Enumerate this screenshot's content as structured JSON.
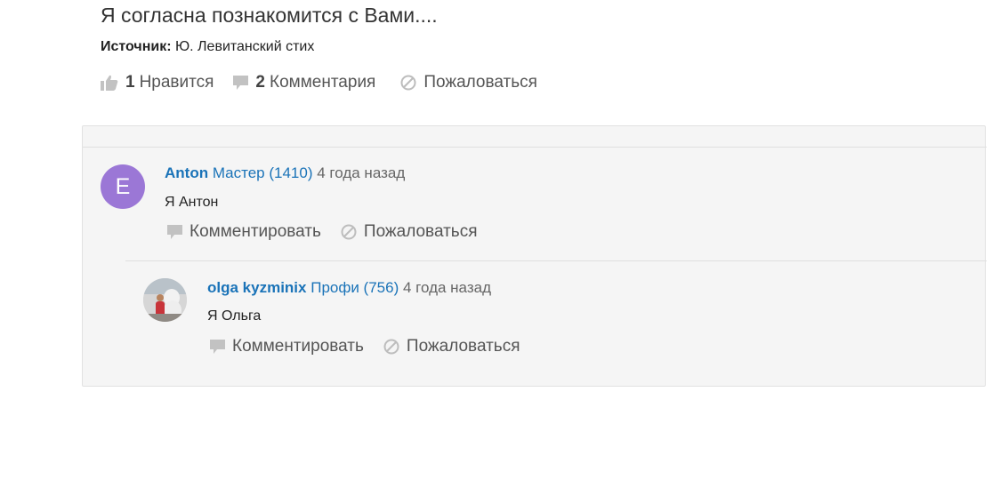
{
  "question": {
    "title": "Я согласна познакомится с Вами....",
    "source_label": "Источник:",
    "source_value": "Ю. Левитанский стих"
  },
  "actions": {
    "like_count": "1",
    "like_label": "Нравится",
    "comment_count": "2",
    "comment_label": "Комментария",
    "report_label": "Пожаловаться"
  },
  "comments": [
    {
      "avatar_letter": "E",
      "avatar_color": "#9b77d6",
      "user": "Anton",
      "rank": "Мастер (1410)",
      "time": "4 года назад",
      "text": "Я Антон",
      "comment_label": "Комментировать",
      "report_label": "Пожаловаться"
    },
    {
      "user": "olga kyzminix",
      "rank": "Профи (756)",
      "time": "4 года назад",
      "text": "Я Ольга",
      "comment_label": "Комментировать",
      "report_label": "Пожаловаться"
    }
  ],
  "colors": {
    "link": "#1a73b8",
    "panel_bg": "#f5f5f5",
    "text": "#333333"
  },
  "icons": [
    "thumbs-up-icon",
    "speech-bubble-icon",
    "ban-icon"
  ]
}
